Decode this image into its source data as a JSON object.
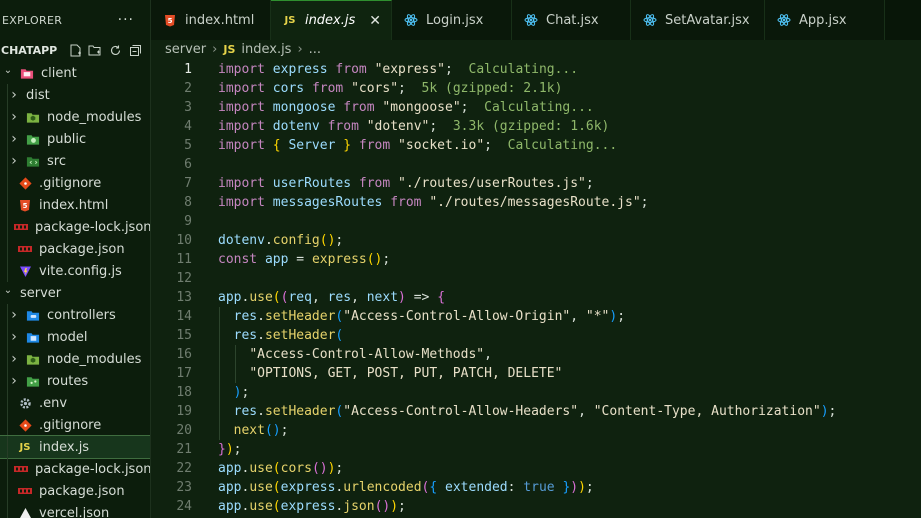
{
  "explorer": {
    "title": "EXPLORER",
    "more": "···",
    "project": "CHATAPP",
    "actions": [
      "new-file",
      "new-folder",
      "refresh",
      "collapse"
    ]
  },
  "tree": [
    {
      "label": "client",
      "kind": "folder-open",
      "depth": 0,
      "icon": "client-folder-icon"
    },
    {
      "label": "dist",
      "kind": "folder",
      "depth": 1,
      "icon": "none"
    },
    {
      "label": "node_modules",
      "kind": "folder",
      "depth": 1,
      "icon": "node-folder-icon"
    },
    {
      "label": "public",
      "kind": "folder",
      "depth": 1,
      "icon": "public-folder-icon"
    },
    {
      "label": "src",
      "kind": "folder",
      "depth": 1,
      "icon": "src-folder-icon"
    },
    {
      "label": ".gitignore",
      "kind": "file",
      "depth": 1,
      "icon": "git-icon"
    },
    {
      "label": "index.html",
      "kind": "file",
      "depth": 1,
      "icon": "html-icon"
    },
    {
      "label": "package-lock.json",
      "kind": "file",
      "depth": 1,
      "icon": "npm-icon"
    },
    {
      "label": "package.json",
      "kind": "file",
      "depth": 1,
      "icon": "npm-icon"
    },
    {
      "label": "vite.config.js",
      "kind": "file",
      "depth": 1,
      "icon": "vite-icon"
    },
    {
      "label": "server",
      "kind": "folder-open",
      "depth": 0,
      "icon": "none"
    },
    {
      "label": "controllers",
      "kind": "folder",
      "depth": 1,
      "icon": "controllers-folder-icon"
    },
    {
      "label": "model",
      "kind": "folder",
      "depth": 1,
      "icon": "model-folder-icon"
    },
    {
      "label": "node_modules",
      "kind": "folder",
      "depth": 1,
      "icon": "node-folder-icon"
    },
    {
      "label": "routes",
      "kind": "folder",
      "depth": 1,
      "icon": "routes-folder-icon"
    },
    {
      "label": ".env",
      "kind": "file",
      "depth": 1,
      "icon": "gear-icon"
    },
    {
      "label": ".gitignore",
      "kind": "file",
      "depth": 1,
      "icon": "git-icon"
    },
    {
      "label": "index.js",
      "kind": "file",
      "depth": 1,
      "icon": "js-icon",
      "selected": true
    },
    {
      "label": "package-lock.json",
      "kind": "file",
      "depth": 1,
      "icon": "npm-icon"
    },
    {
      "label": "package.json",
      "kind": "file",
      "depth": 1,
      "icon": "npm-icon"
    },
    {
      "label": "vercel.json",
      "kind": "file",
      "depth": 1,
      "icon": "vercel-icon"
    }
  ],
  "tabs": [
    {
      "label": "index.html",
      "icon": "html-icon",
      "active": false
    },
    {
      "label": "index.js",
      "icon": "js-icon",
      "active": true,
      "close": "✕"
    },
    {
      "label": "Login.jsx",
      "icon": "react-icon",
      "active": false
    },
    {
      "label": "Chat.jsx",
      "icon": "react-icon",
      "active": false
    },
    {
      "label": "SetAvatar.jsx",
      "icon": "react-icon",
      "active": false
    },
    {
      "label": "App.jsx",
      "icon": "react-icon",
      "active": false
    }
  ],
  "breadcrumb": {
    "folder": "server",
    "file": "index.js",
    "symbol": "..."
  },
  "editor": {
    "current_line": 1,
    "lines": [
      [
        [
          "kw",
          "import "
        ],
        [
          "id",
          "express "
        ],
        [
          "kw",
          "from "
        ],
        [
          "str",
          "\"express\""
        ],
        [
          "pu",
          ";  "
        ],
        [
          "hint",
          "Calculating..."
        ]
      ],
      [
        [
          "kw",
          "import "
        ],
        [
          "id",
          "cors "
        ],
        [
          "kw",
          "from "
        ],
        [
          "str",
          "\"cors\""
        ],
        [
          "pu",
          ";  "
        ],
        [
          "hint",
          "5k (gzipped: 2.1k)"
        ]
      ],
      [
        [
          "kw",
          "import "
        ],
        [
          "id",
          "mongoose "
        ],
        [
          "kw",
          "from "
        ],
        [
          "str",
          "\"mongoose\""
        ],
        [
          "pu",
          ";  "
        ],
        [
          "hint",
          "Calculating..."
        ]
      ],
      [
        [
          "kw",
          "import "
        ],
        [
          "id",
          "dotenv "
        ],
        [
          "kw",
          "from "
        ],
        [
          "str",
          "\"dotenv\""
        ],
        [
          "pu",
          ";  "
        ],
        [
          "hint",
          "3.3k (gzipped: 1.6k)"
        ]
      ],
      [
        [
          "kw",
          "import "
        ],
        [
          "br1",
          "{ "
        ],
        [
          "id",
          "Server "
        ],
        [
          "br1",
          "} "
        ],
        [
          "kw",
          "from "
        ],
        [
          "str",
          "\"socket.io\""
        ],
        [
          "pu",
          ";  "
        ],
        [
          "hint",
          "Calculating..."
        ]
      ],
      [],
      [
        [
          "kw",
          "import "
        ],
        [
          "id",
          "userRoutes "
        ],
        [
          "kw",
          "from "
        ],
        [
          "str",
          "\"./routes/userRoutes.js\""
        ],
        [
          "pu",
          ";"
        ]
      ],
      [
        [
          "kw",
          "import "
        ],
        [
          "id",
          "messagesRoutes "
        ],
        [
          "kw",
          "from "
        ],
        [
          "str",
          "\"./routes/messagesRoute.js\""
        ],
        [
          "pu",
          ";"
        ]
      ],
      [],
      [
        [
          "id",
          "dotenv"
        ],
        [
          "pu",
          "."
        ],
        [
          "fn",
          "config"
        ],
        [
          "br1",
          "()"
        ],
        [
          "pu",
          ";"
        ]
      ],
      [
        [
          "kw",
          "const "
        ],
        [
          "id",
          "app "
        ],
        [
          "pu",
          "= "
        ],
        [
          "fn",
          "express"
        ],
        [
          "br1",
          "()"
        ],
        [
          "pu",
          ";"
        ]
      ],
      [],
      [
        [
          "id",
          "app"
        ],
        [
          "pu",
          "."
        ],
        [
          "fn",
          "use"
        ],
        [
          "br1",
          "("
        ],
        [
          "br2",
          "("
        ],
        [
          "id",
          "req"
        ],
        [
          "pu",
          ", "
        ],
        [
          "id",
          "res"
        ],
        [
          "pu",
          ", "
        ],
        [
          "id",
          "next"
        ],
        [
          "br2",
          ")"
        ],
        [
          "pu",
          " => "
        ],
        [
          "br2",
          "{"
        ]
      ],
      [
        [
          "pu",
          "  "
        ],
        [
          "id",
          "res"
        ],
        [
          "pu",
          "."
        ],
        [
          "fn",
          "setHeader"
        ],
        [
          "br3",
          "("
        ],
        [
          "str",
          "\"Access-Control-Allow-Origin\""
        ],
        [
          "pu",
          ", "
        ],
        [
          "str",
          "\"*\""
        ],
        [
          "br3",
          ")"
        ],
        [
          "pu",
          ";"
        ]
      ],
      [
        [
          "pu",
          "  "
        ],
        [
          "id",
          "res"
        ],
        [
          "pu",
          "."
        ],
        [
          "fn",
          "setHeader"
        ],
        [
          "br3",
          "("
        ]
      ],
      [
        [
          "pu",
          "    "
        ],
        [
          "str",
          "\"Access-Control-Allow-Methods\""
        ],
        [
          "pu",
          ","
        ]
      ],
      [
        [
          "pu",
          "    "
        ],
        [
          "str",
          "\"OPTIONS, GET, POST, PUT, PATCH, DELETE\""
        ]
      ],
      [
        [
          "pu",
          "  "
        ],
        [
          "br3",
          ")"
        ],
        [
          "pu",
          ";"
        ]
      ],
      [
        [
          "pu",
          "  "
        ],
        [
          "id",
          "res"
        ],
        [
          "pu",
          "."
        ],
        [
          "fn",
          "setHeader"
        ],
        [
          "br3",
          "("
        ],
        [
          "str",
          "\"Access-Control-Allow-Headers\""
        ],
        [
          "pu",
          ", "
        ],
        [
          "str",
          "\"Content-Type, Authorization\""
        ],
        [
          "br3",
          ")"
        ],
        [
          "pu",
          ";"
        ]
      ],
      [
        [
          "pu",
          "  "
        ],
        [
          "fn",
          "next"
        ],
        [
          "br3",
          "()"
        ],
        [
          "pu",
          ";"
        ]
      ],
      [
        [
          "br2",
          "}"
        ],
        [
          "br1",
          ")"
        ],
        [
          "pu",
          ";"
        ]
      ],
      [
        [
          "id",
          "app"
        ],
        [
          "pu",
          "."
        ],
        [
          "fn",
          "use"
        ],
        [
          "br1",
          "("
        ],
        [
          "fn",
          "cors"
        ],
        [
          "br2",
          "()"
        ],
        [
          "br1",
          ")"
        ],
        [
          "pu",
          ";"
        ]
      ],
      [
        [
          "id",
          "app"
        ],
        [
          "pu",
          "."
        ],
        [
          "fn",
          "use"
        ],
        [
          "br1",
          "("
        ],
        [
          "id",
          "express"
        ],
        [
          "pu",
          "."
        ],
        [
          "fn",
          "urlencoded"
        ],
        [
          "br2",
          "("
        ],
        [
          "br3",
          "{ "
        ],
        [
          "id",
          "extended"
        ],
        [
          "pu",
          ": "
        ],
        [
          "const",
          "true "
        ],
        [
          "br3",
          "}"
        ],
        [
          "br2",
          ")"
        ],
        [
          "br1",
          ")"
        ],
        [
          "pu",
          ";"
        ]
      ],
      [
        [
          "id",
          "app"
        ],
        [
          "pu",
          "."
        ],
        [
          "fn",
          "use"
        ],
        [
          "br1",
          "("
        ],
        [
          "id",
          "express"
        ],
        [
          "pu",
          "."
        ],
        [
          "fn",
          "json"
        ],
        [
          "br2",
          "()"
        ],
        [
          "br1",
          ")"
        ],
        [
          "pu",
          ";"
        ]
      ]
    ]
  },
  "colors": {
    "background": "#0f220f",
    "sidebar": "#0c1d0c",
    "keyword": "#c586c0",
    "identifier": "#9cdcfe",
    "function": "#e6d36b",
    "string": "#e8e0c8",
    "hint": "#8fb86a",
    "selection": "#17361c"
  }
}
